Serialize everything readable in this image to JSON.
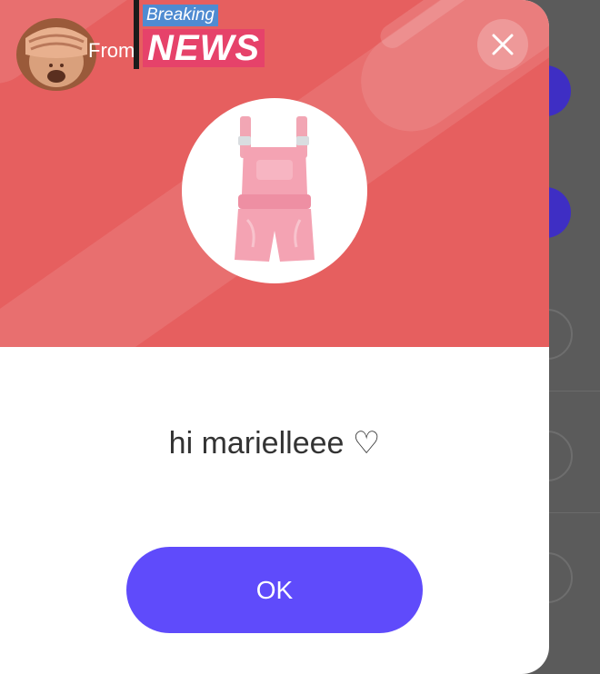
{
  "modal": {
    "sender_prefix": "From",
    "sticker_top": "Breaking",
    "sticker_main": "NEWS",
    "message": "hi marielleee ♡",
    "ok_label": "OK",
    "item_icon": "pink-overalls-romper",
    "sender_icon": "see-no-evil-monkey",
    "close_icon": "close-x"
  },
  "colors": {
    "hero_background": "#e65f5f",
    "button_primary": "#5f4bfb",
    "background_accent": "#3e2ec4"
  }
}
